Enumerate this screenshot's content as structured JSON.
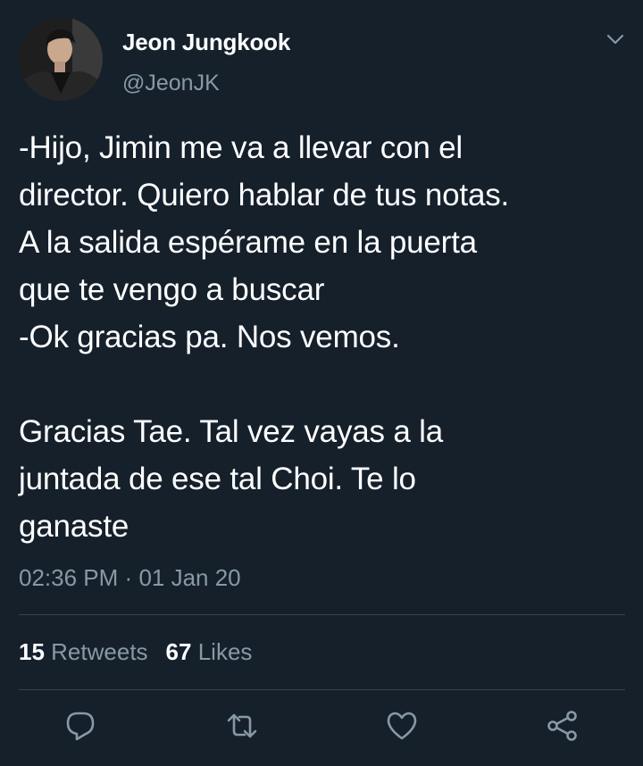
{
  "author": {
    "display_name": "Jeon Jungkook",
    "handle": "@JeonJK",
    "avatar_icon": "profile-photo"
  },
  "tweet": {
    "text": "-Hijo, Jimin me va a llevar con el\ndirector. Quiero hablar de tus notas.\nA la salida espérame en la puerta\nque te vengo a buscar\n-Ok gracias pa. Nos vemos.\n\nGracias Tae. Tal vez vayas a la\njuntada de ese tal Choi. Te lo\nganaste",
    "time": "02:36 PM",
    "separator": "·",
    "date": "01 Jan 20"
  },
  "stats": {
    "retweets_count": "15",
    "retweets_label": "Retweets",
    "likes_count": "67",
    "likes_label": "Likes"
  },
  "actions": [
    {
      "name": "reply",
      "icon": "reply-icon"
    },
    {
      "name": "retweet",
      "icon": "retweet-icon"
    },
    {
      "name": "like",
      "icon": "heart-icon"
    },
    {
      "name": "share",
      "icon": "share-icon"
    }
  ],
  "colors": {
    "background": "#15202b",
    "primary_text": "#ffffff",
    "secondary_text": "#8899a6",
    "divider": "#38444d"
  }
}
